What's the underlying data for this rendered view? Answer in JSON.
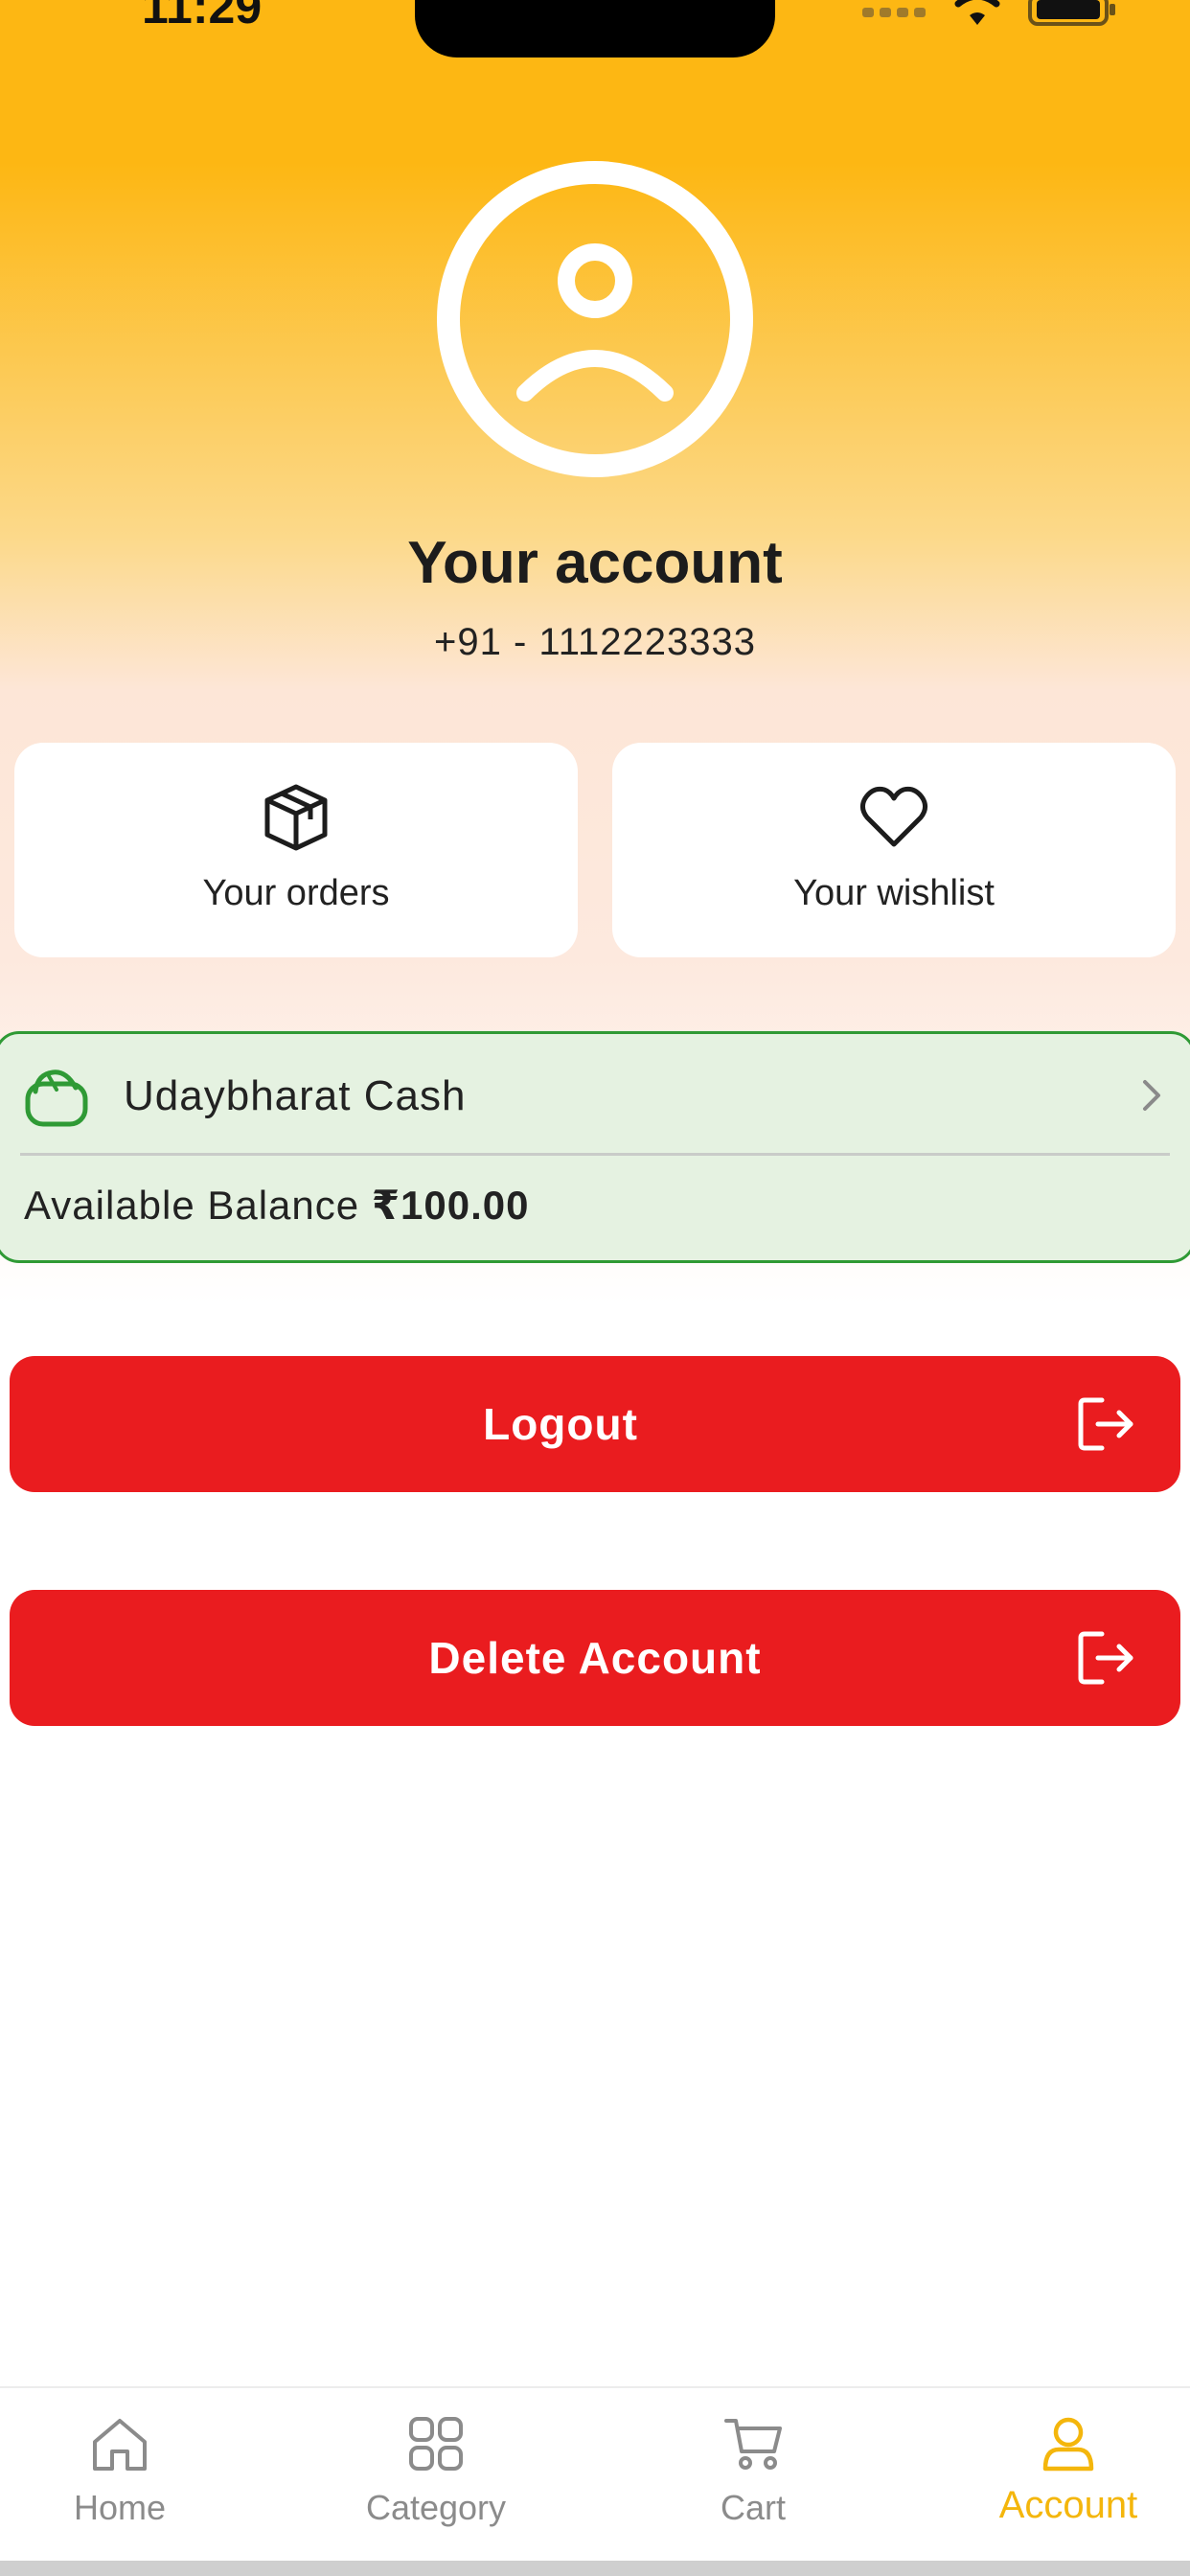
{
  "status_bar": {
    "time": "11:29"
  },
  "profile": {
    "title": "Your account",
    "phone": "+91 - 1112223333"
  },
  "tiles": {
    "orders_label": "Your orders",
    "wishlist_label": "Your wishlist"
  },
  "cash": {
    "label": "Udaybharat Cash",
    "balance_label": "Available Balance",
    "balance_amount": "₹100.00"
  },
  "buttons": {
    "logout": "Logout",
    "delete": "Delete Account"
  },
  "nav": {
    "items": [
      {
        "label": "Home",
        "icon": "home-icon"
      },
      {
        "label": "Category",
        "icon": "grid-icon"
      },
      {
        "label": "Cart",
        "icon": "cart-icon"
      },
      {
        "label": "Account",
        "icon": "user-icon",
        "active": true
      }
    ]
  },
  "colors": {
    "accent": "#fdb713",
    "danger": "#ea1c1f",
    "cash_border": "#2f9a35",
    "nav_active": "#f4b60c"
  }
}
